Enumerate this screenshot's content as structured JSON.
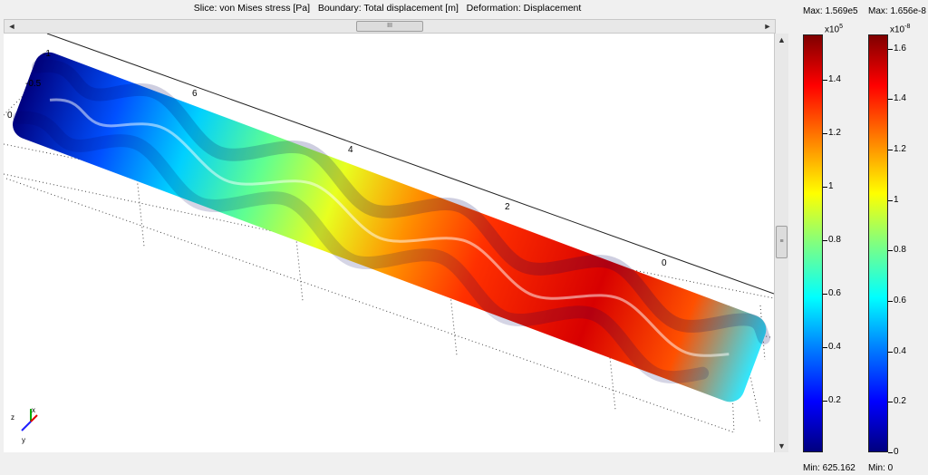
{
  "header": {
    "slice": "Slice: von Mises stress [Pa]",
    "boundary": "Boundary: Total displacement [m]",
    "deformation": "Deformation: Displacement"
  },
  "scrollbar": {
    "grip": "III",
    "left_arrow": "◄",
    "right_arrow": "►",
    "up_arrow": "▲",
    "down_arrow": "▼"
  },
  "axes_labels": {
    "t_n1": "-1",
    "t_n05": "-0.5",
    "t_0": "0",
    "x6": "6",
    "x4": "4",
    "x2": "2",
    "x0": "0"
  },
  "triad": {
    "z": "z",
    "x": "x",
    "y": "y"
  },
  "colorbar1": {
    "max": "Max: 1.569e5",
    "exp": "x10",
    "exp_sup": "5",
    "min": "Min: 625.162",
    "ticks": [
      "1.4",
      "1.2",
      "1",
      "0.8",
      "0.6",
      "0.4",
      "0.2"
    ],
    "tick_values": [
      1.4,
      1.2,
      1.0,
      0.8,
      0.6,
      0.4,
      0.2
    ],
    "range": [
      0.00625162,
      1.569
    ]
  },
  "colorbar2": {
    "max": "Max: 1.656e-8",
    "exp": "x10",
    "exp_sup": "-8",
    "min": "Min: 0",
    "ticks": [
      "1.6",
      "1.4",
      "1.2",
      "1",
      "0.8",
      "0.6",
      "0.4",
      "0.2",
      "0"
    ],
    "tick_values": [
      1.6,
      1.4,
      1.2,
      1.0,
      0.8,
      0.6,
      0.4,
      0.2,
      0
    ],
    "range": [
      0,
      1.656
    ]
  },
  "colors": {
    "jet": [
      "#00007f",
      "#0000ff",
      "#0080ff",
      "#00ffff",
      "#80ff80",
      "#ffff00",
      "#ff8000",
      "#ff0000",
      "#7f0000"
    ]
  }
}
